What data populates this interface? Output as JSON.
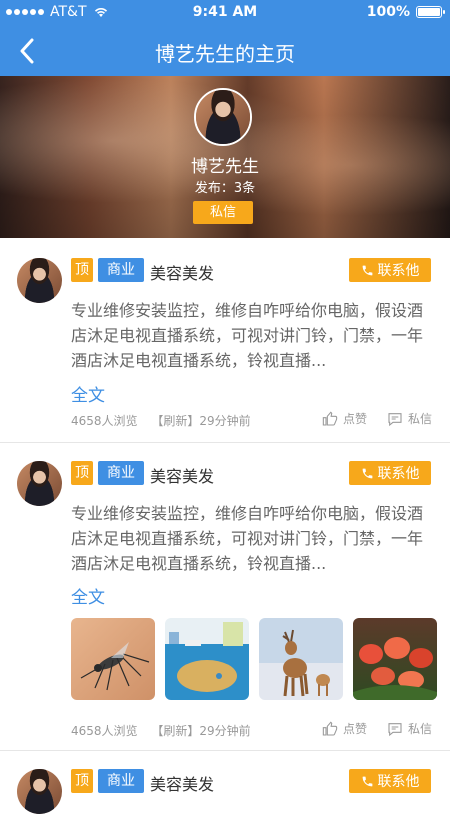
{
  "status_bar": {
    "carrier": "AT&T",
    "time": "9:41 AM",
    "battery": "100%"
  },
  "nav": {
    "title": "博艺先生的主页"
  },
  "profile": {
    "name": "博艺先生",
    "post_count": "发布：3条",
    "message_button": "私信"
  },
  "posts": [
    {
      "badge_top": "顶",
      "badge_type": "商业",
      "category": "美容美发",
      "contact_label": "联系他",
      "body": "专业维修安装监控，维修自咋呼给你电脑，假设酒店沐足电视直播系统，可视对讲门铃，门禁，一年酒店沐足电视直播系统，铃视直播...",
      "full_text_link": "全文",
      "views": "4658人浏览",
      "refresh": "【刷新】29分钟前",
      "like_label": "点赞",
      "message_label": "私信"
    },
    {
      "badge_top": "顶",
      "badge_type": "商业",
      "category": "美容美发",
      "contact_label": "联系他",
      "body": "专业维修安装监控，维修自咋呼给你电脑，假设酒店沐足电视直播系统，可视对讲门铃，门禁，一年酒店沐足电视直播系统，铃视直播...",
      "full_text_link": "全文",
      "views": "4658人浏览",
      "refresh": "【刷新】29分钟前",
      "like_label": "点赞",
      "message_label": "私信",
      "images": [
        "mosquito-photo",
        "classroom-photo",
        "deer-illustration",
        "tulips-photo"
      ]
    },
    {
      "badge_top": "顶",
      "badge_type": "商业",
      "category": "美容美发",
      "contact_label": "联系他"
    }
  ],
  "colors": {
    "primary": "#3f8fe3",
    "accent": "#f7a81b"
  }
}
